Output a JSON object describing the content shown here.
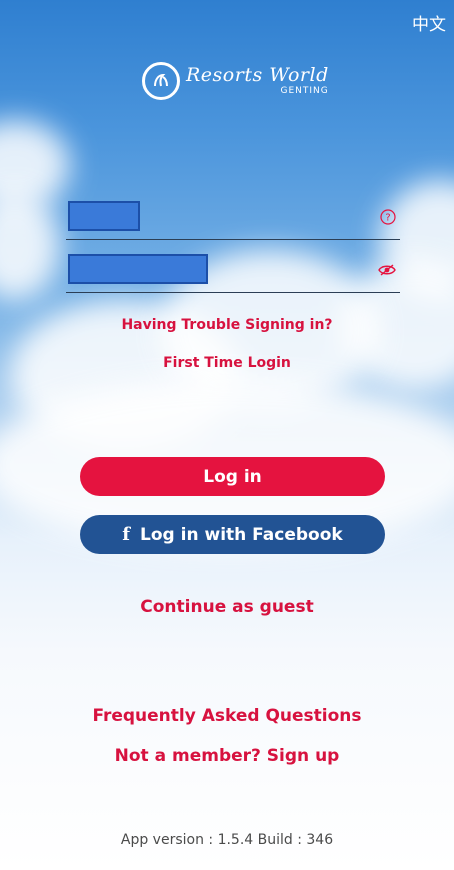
{
  "header": {
    "language_toggle": "中文"
  },
  "logo": {
    "title": "Resorts World",
    "subtitle": "GENTING"
  },
  "form": {
    "username_help_icon": "question-circle-icon",
    "password_toggle_icon": "eye-icon",
    "trouble_link": "Having Trouble Signing in?",
    "first_time_link": "First Time Login"
  },
  "actions": {
    "login_label": "Log in",
    "facebook_label": "Log in with Facebook",
    "facebook_icon": "f",
    "guest_label": "Continue as guest"
  },
  "footer": {
    "faq_link": "Frequently Asked Questions",
    "signup_link": "Not a member? Sign up",
    "version_text": "App version : 1.5.4  Build : 346"
  },
  "colors": {
    "accent": "#e5133f",
    "facebook": "#225394",
    "link": "#d7123f"
  }
}
